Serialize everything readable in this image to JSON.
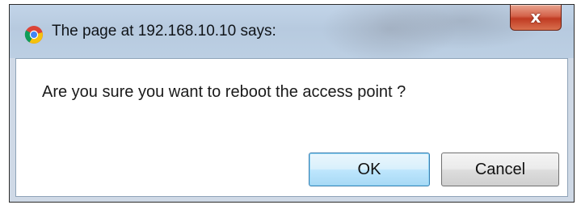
{
  "dialog": {
    "title": "The page at 192.168.10.10 says:",
    "close_label": "x",
    "message": "Are you sure you want to reboot the access point ?",
    "ok_label": "OK",
    "cancel_label": "Cancel"
  },
  "icons": {
    "app_icon": "chrome-icon",
    "close_icon": "close-icon"
  },
  "colors": {
    "title_bar": "#bccfe3",
    "close_button": "#c03a22",
    "default_button_border": "#3c7fb1"
  }
}
